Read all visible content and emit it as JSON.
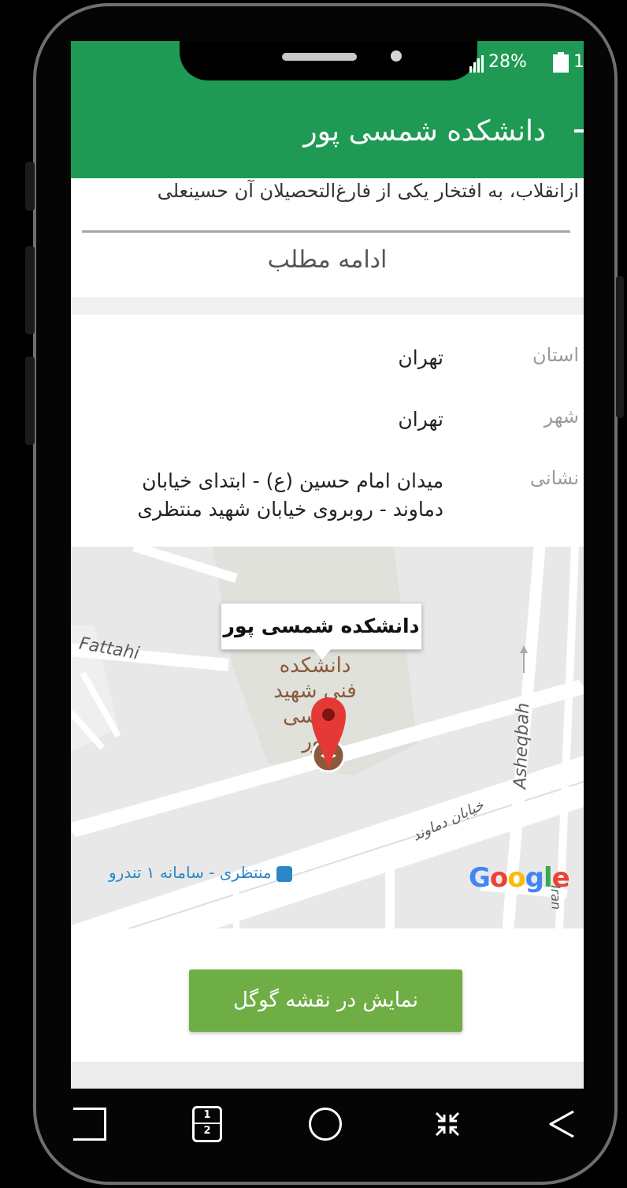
{
  "status": {
    "battery_percent": "28%",
    "battery_partial_digit": "1"
  },
  "app_bar": {
    "title": "دانشکده شمسی پور"
  },
  "intro": {
    "text": "ازانقلاب، به افتخار یکی از فارغ‌التحصیلان آن حسینعلی",
    "more_label": "ادامه مطلب"
  },
  "details": [
    {
      "label": "استان",
      "value": "تهران"
    },
    {
      "label": "شهر",
      "value": "تهران"
    },
    {
      "label": "نشانی",
      "value": "میدان امام حسین (ع) - ابتدای خیابان دماوند - روبروی خیابان شهید منتظری"
    }
  ],
  "map": {
    "callout": "دانشکده شمسی پور",
    "poi_label": "دانشکده فنی شهید شمسی پور",
    "street_fattahi": "Fattahi",
    "street_asheqbah": "Asheqbah",
    "street_damavand": "خیابان دماوند",
    "street_iran": "Iran",
    "brt_station": "منتظری - سامانه ۱ تندرو",
    "attribution": "Google",
    "marker_color": "#e53935",
    "poi_icon_color": "#8b5a3c"
  },
  "actions": {
    "open_in_google_maps": "نمایش در نقشه گوگل"
  },
  "nav": {
    "split_numbers": [
      "1",
      "2"
    ]
  },
  "colors": {
    "header_green": "#1f9a54",
    "button_green": "#6fae44"
  }
}
